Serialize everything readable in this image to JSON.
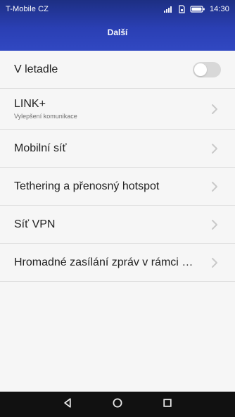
{
  "status_bar": {
    "carrier": "T-Mobile CZ",
    "time": "14:30",
    "icons": [
      "signal-icon",
      "sim-icon",
      "battery-icon"
    ]
  },
  "title_bar": {
    "title": "Další"
  },
  "settings": {
    "items": [
      {
        "label": "V letadle",
        "type": "toggle",
        "enabled": false
      },
      {
        "label": "LINK+",
        "sublabel": "Vylepšení komunikace",
        "type": "chevron"
      },
      {
        "label": "Mobilní síť",
        "type": "chevron"
      },
      {
        "label": "Tethering a přenosný hotspot",
        "type": "chevron"
      },
      {
        "label": "Síť VPN",
        "type": "chevron"
      },
      {
        "label": "Hromadné zasílání zpráv v rámci b...",
        "type": "chevron"
      }
    ]
  },
  "nav_bar": {
    "icons": [
      "back-icon",
      "home-icon",
      "recent-apps-icon"
    ]
  },
  "colors": {
    "header_start": "#1d2f83",
    "header_end": "#3148c2",
    "background": "#f6f6f6",
    "divider": "#dedede",
    "toggle_off": "#d8d8d8",
    "nav_bar": "#111111"
  }
}
